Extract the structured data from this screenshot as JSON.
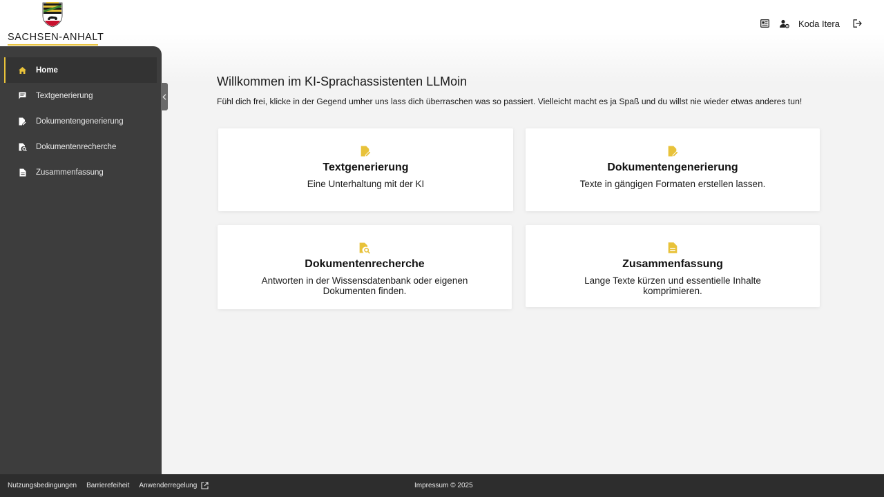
{
  "logo": {
    "text": "SACHSEN-ANHALT",
    "accent": "#e8c23a"
  },
  "header": {
    "user_name": "Koda Itera",
    "icons": [
      "news-icon",
      "user-settings-icon",
      "logout-icon"
    ]
  },
  "sidebar": {
    "items": [
      {
        "label": "Home",
        "icon": "home-icon",
        "active": true
      },
      {
        "label": "Textgenerierung",
        "icon": "chat-icon",
        "active": false
      },
      {
        "label": "Dokumentengenerierung",
        "icon": "edit-document-icon",
        "active": false
      },
      {
        "label": "Dokumentenrecherche",
        "icon": "document-search-icon",
        "active": false
      },
      {
        "label": "Zusammenfassung",
        "icon": "document-icon",
        "active": false
      }
    ]
  },
  "main": {
    "title": "Willkommen im KI-Sprachassistenten LLMoin",
    "intro": "Fühl dich frei, klicke in der Gegend umher uns lass dich überraschen was so passiert. Vielleicht macht es ja Spaß und du willst nie wieder etwas anderes tun!",
    "cards": [
      {
        "title": "Textgenerierung",
        "description": "Eine Unterhaltung mit der KI",
        "icon": "edit-document-icon"
      },
      {
        "title": "Dokumentengenerierung",
        "description": "Texte in gängigen Formaten erstellen lassen.",
        "icon": "edit-document-icon"
      },
      {
        "title": "Dokumentenrecherche",
        "description": "Antworten in der Wissensdatenbank oder eigenen Dokumenten finden.",
        "icon": "document-search-icon"
      },
      {
        "title": "Zusammenfassung",
        "description": "Lange Texte kürzen und essentielle Inhalte komprimieren.",
        "icon": "document-icon"
      }
    ]
  },
  "footer": {
    "links": [
      "Nutzungsbedingungen",
      "Barrierefeiheit",
      "Anwenderregelung"
    ],
    "center": "Impressum © 2025"
  },
  "colors": {
    "accent": "#e8c23a",
    "sidebar": "#3d3d3d",
    "footer": "#2d2d2d",
    "background": "#f3f3f3"
  }
}
